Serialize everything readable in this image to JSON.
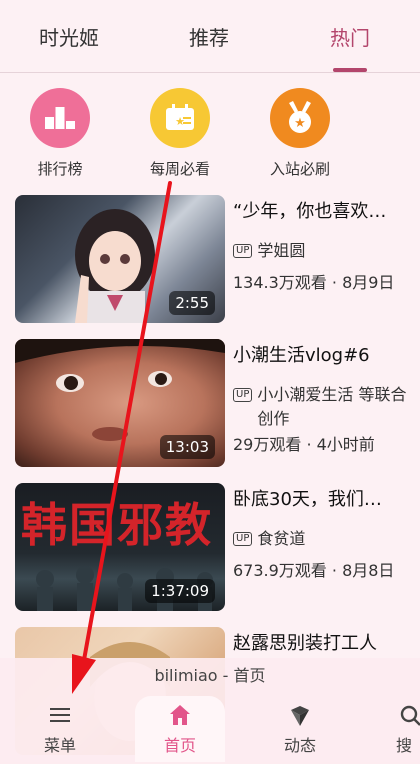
{
  "tabs": [
    {
      "label": "时光姬"
    },
    {
      "label": "推荐"
    },
    {
      "label": "热门"
    }
  ],
  "quick_entries": [
    {
      "label": "排行榜",
      "icon": "ranking-icon",
      "color": "#ef6f98"
    },
    {
      "label": "每周必看",
      "icon": "weekly-calendar-icon",
      "color": "#f7c834"
    },
    {
      "label": "入站必刷",
      "icon": "medal-icon",
      "color": "#f08a1f"
    }
  ],
  "videos": [
    {
      "title": "“少年，你也喜欢…",
      "author": "学姐圆",
      "stats": "134.3万观看 · 8月9日",
      "duration": "2:55"
    },
    {
      "title": "小潮生活vlog#6",
      "author": "小小潮爱生活 等联合创作",
      "stats": "29万观看 · 4小时前",
      "duration": "13:03"
    },
    {
      "title": "卧底30天，我们…",
      "author": "食贫道",
      "stats": "673.9万观看 · 8月8日",
      "duration": "1:37:09"
    },
    {
      "title": "赵露思别装打工人",
      "author": "",
      "stats": "",
      "duration": ""
    }
  ],
  "thumb_text": {
    "video3": "韩国邪教"
  },
  "bottom_nav": {
    "title": "bilimiao - 首页",
    "items": [
      {
        "label": "菜单",
        "icon": "menu-icon"
      },
      {
        "label": "首页",
        "icon": "home-icon"
      },
      {
        "label": "动态",
        "icon": "dynamic-icon"
      },
      {
        "label": "搜",
        "icon": "search-icon"
      }
    ]
  },
  "badge_label": "UP",
  "colors": {
    "accent": "#b3466c",
    "nav_active": "#e2558a",
    "arrow": "#e8141c"
  }
}
